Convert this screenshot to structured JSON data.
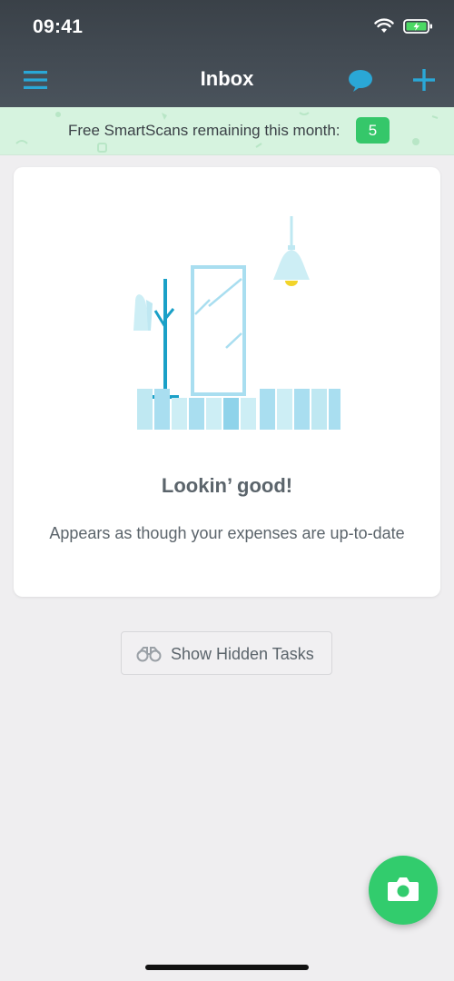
{
  "status_bar": {
    "time": "09:41"
  },
  "header": {
    "title": "Inbox"
  },
  "banner": {
    "text": "Free SmartScans remaining this month:",
    "remaining": "5"
  },
  "empty_state": {
    "title": "Lookin’ good!",
    "subtitle": "Appears as though your expenses are up-to-date"
  },
  "hidden_tasks": {
    "label": "Show Hidden Tasks"
  },
  "icons": {
    "menu": "hamburger-menu-icon",
    "chat": "chat-bubble-icon",
    "add": "plus-icon",
    "hidden": "binoculars-icon",
    "camera": "camera-icon"
  },
  "colors": {
    "accent_blue": "#2aa7d6",
    "accent_green": "#32cc6d",
    "header_bg": "#3a4148",
    "banner_bg": "#d6f3df"
  }
}
